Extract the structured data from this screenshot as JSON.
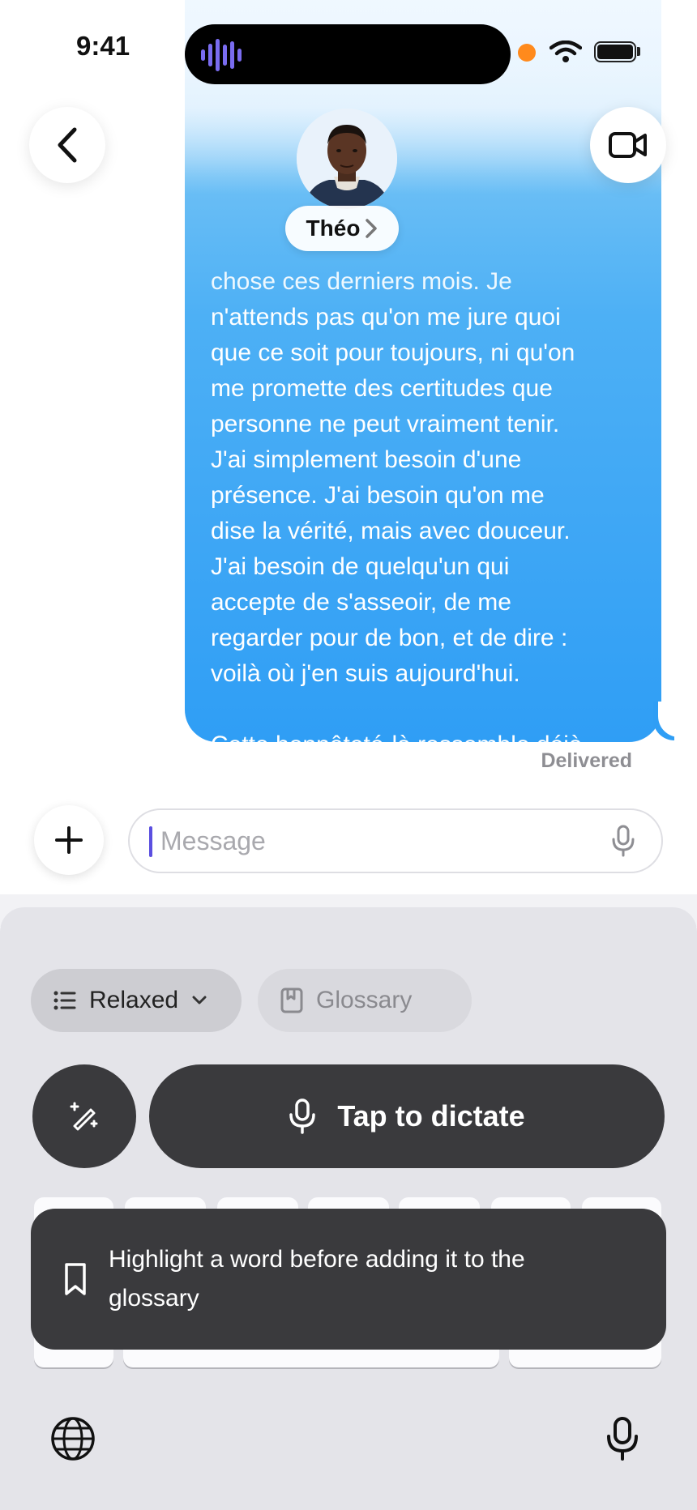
{
  "status_bar": {
    "time": "9:41"
  },
  "contact": {
    "name": "Théo"
  },
  "message": {
    "top_faded_line": "chose ces derniers mois. Je",
    "body": "n'attends pas qu'on me jure quoi\nque ce soit pour toujours, ni qu'on\nme promette des certitudes que\npersonne ne peut vraiment tenir.\nJ'ai simplement besoin d'une\nprésence. J'ai besoin qu'on me\ndise la vérité, mais avec douceur.\nJ'ai besoin de quelqu'un qui\naccepte de s'asseoir, de me\nregarder pour de bon, et de dire :\nvoilà où j'en suis aujourd'hui.\n\nCette honnêteté-là ressemble déjà\nà quelque chose de beau.",
    "status": "Delivered"
  },
  "composer": {
    "placeholder": "Message"
  },
  "keyboard": {
    "tone_chip_label": "Relaxed",
    "glossary_chip_label": "Glossary",
    "dictate_label": "Tap to dictate",
    "toast_text": "Highlight a word before adding it to the glossary"
  },
  "colors": {
    "bubble_blue": "#3da6f5",
    "dark_button": "#3a3a3d",
    "keyboard_bg": "#e4e4e9",
    "waveform_purple": "#7a6cf0",
    "recording_dot": "#ff8a1c"
  },
  "icons": [
    "back-chevron-icon",
    "video-camera-icon",
    "chevron-right-icon",
    "plus-icon",
    "microphone-icon",
    "list-icon",
    "chevron-down-icon",
    "bookmark-book-icon",
    "magic-wand-icon",
    "bookmark-icon",
    "globe-icon"
  ]
}
